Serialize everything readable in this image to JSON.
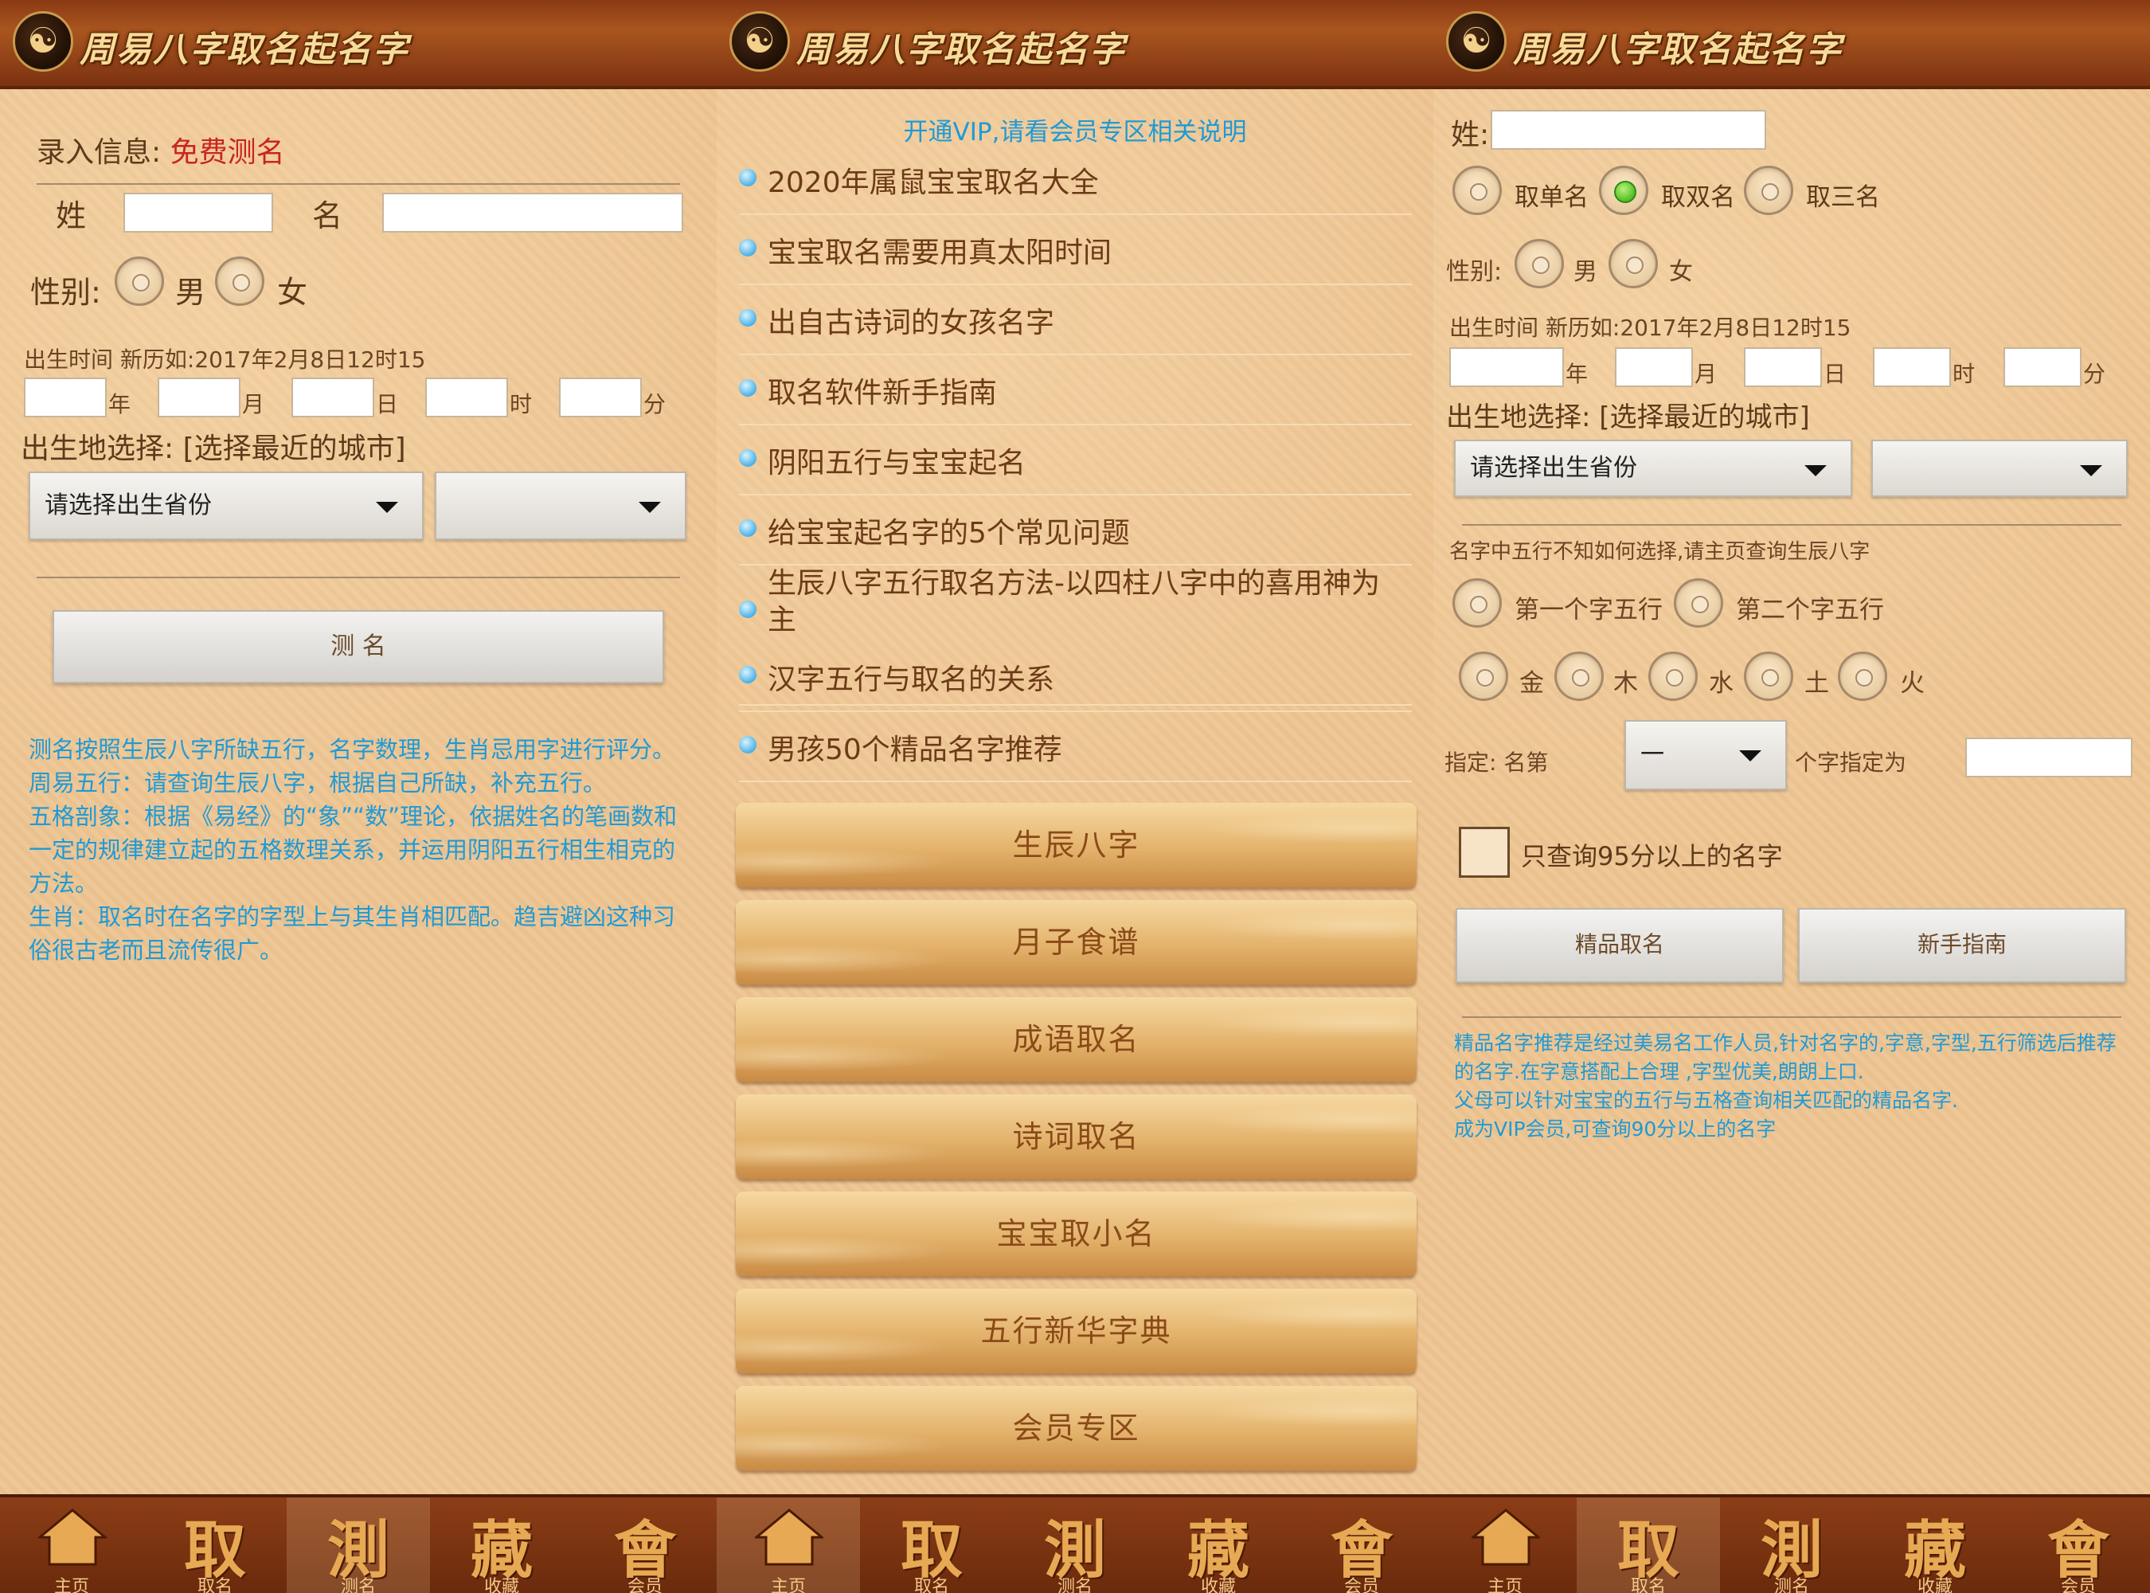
{
  "app": {
    "title": "周易八字取名起名字"
  },
  "tabs": [
    {
      "glyph": "⌂",
      "label": "主页"
    },
    {
      "glyph": "取",
      "label": "取名"
    },
    {
      "glyph": "測",
      "label": "测名"
    },
    {
      "glyph": "藏",
      "label": "收藏"
    },
    {
      "glyph": "會",
      "label": "会员"
    }
  ],
  "p1": {
    "section_label": "录入信息:",
    "section_value": "免费测名",
    "surname_label": "姓",
    "given_label": "名",
    "gender_label": "性别:",
    "male": "男",
    "female": "女",
    "birth_label": "出生时间  新历如:2017年2月8日12时15",
    "units": [
      "年",
      "月",
      "日",
      "时",
      "分"
    ],
    "place_label": "出生地选择: [选择最近的城市]",
    "province_select": "请选择出生省份",
    "city_select": "",
    "submit": "测  名",
    "desc": [
      "测名按照生辰八字所缺五行，名字数理，生肖忌用字进行评分。",
      "周易五行：请查询生辰八字，根据自己所缺，补充五行。",
      "五格剖象：根据《易经》的“象”“数”理论，依据姓名的笔画数和一定的规律建立起的五格数理关系，并运用阴阳五行相生相克的方法。",
      "生肖：取名时在名字的字型上与其生肖相匹配。趋吉避凶这种习俗很古老而且流传很广。"
    ]
  },
  "p2": {
    "vip_notice": "开通VIP,请看会员专区相关说明",
    "articles": [
      "2020年属鼠宝宝取名大全",
      "宝宝取名需要用真太阳时间",
      "出自古诗词的女孩名字",
      "取名软件新手指南",
      "阴阳五行与宝宝起名",
      "给宝宝起名字的5个常见问题",
      "生辰八字五行取名方法-以四柱八字中的喜用神为主",
      "汉字五行与取名的关系",
      "男孩50个精品名字推荐"
    ],
    "menu": [
      "生辰八字",
      "月子食谱",
      "成语取名",
      "诗词取名",
      "宝宝取小名",
      "五行新华字典",
      "会员专区"
    ]
  },
  "p3": {
    "surname_label": "姓:",
    "name_count": [
      "取单名",
      "取双名",
      "取三名"
    ],
    "gender_label": "性别:",
    "male": "男",
    "female": "女",
    "birth_label": "出生时间  新历如:2017年2月8日12时15",
    "units": [
      "年",
      "月",
      "日",
      "时",
      "分"
    ],
    "place_label": "出生地选择: [选择最近的城市]",
    "province_select": "请选择出生省份",
    "city_select": "",
    "wuxing_hint": "名字中五行不知如何选择,请主页查询生辰八字",
    "char_wuxing": [
      "第一个字五行",
      "第二个字五行"
    ],
    "elements": [
      "金",
      "木",
      "水",
      "土",
      "火"
    ],
    "specify_label": "指定: 名第",
    "specify_select": "一",
    "specify_suffix": "个字指定为",
    "only95": "只查询95分以上的名字",
    "btn_quality": "精品取名",
    "btn_guide": "新手指南",
    "desc": [
      "精品名字推荐是经过美易名工作人员,针对名字的,字意,字型,五行筛选后推荐的名字.在字意搭配上合理 ,字型优美,朗朗上口.",
      "父母可以针对宝宝的五行与五格查询相关匹配的精品名字.",
      "成为VIP会员,可查询90分以上的名字"
    ]
  }
}
